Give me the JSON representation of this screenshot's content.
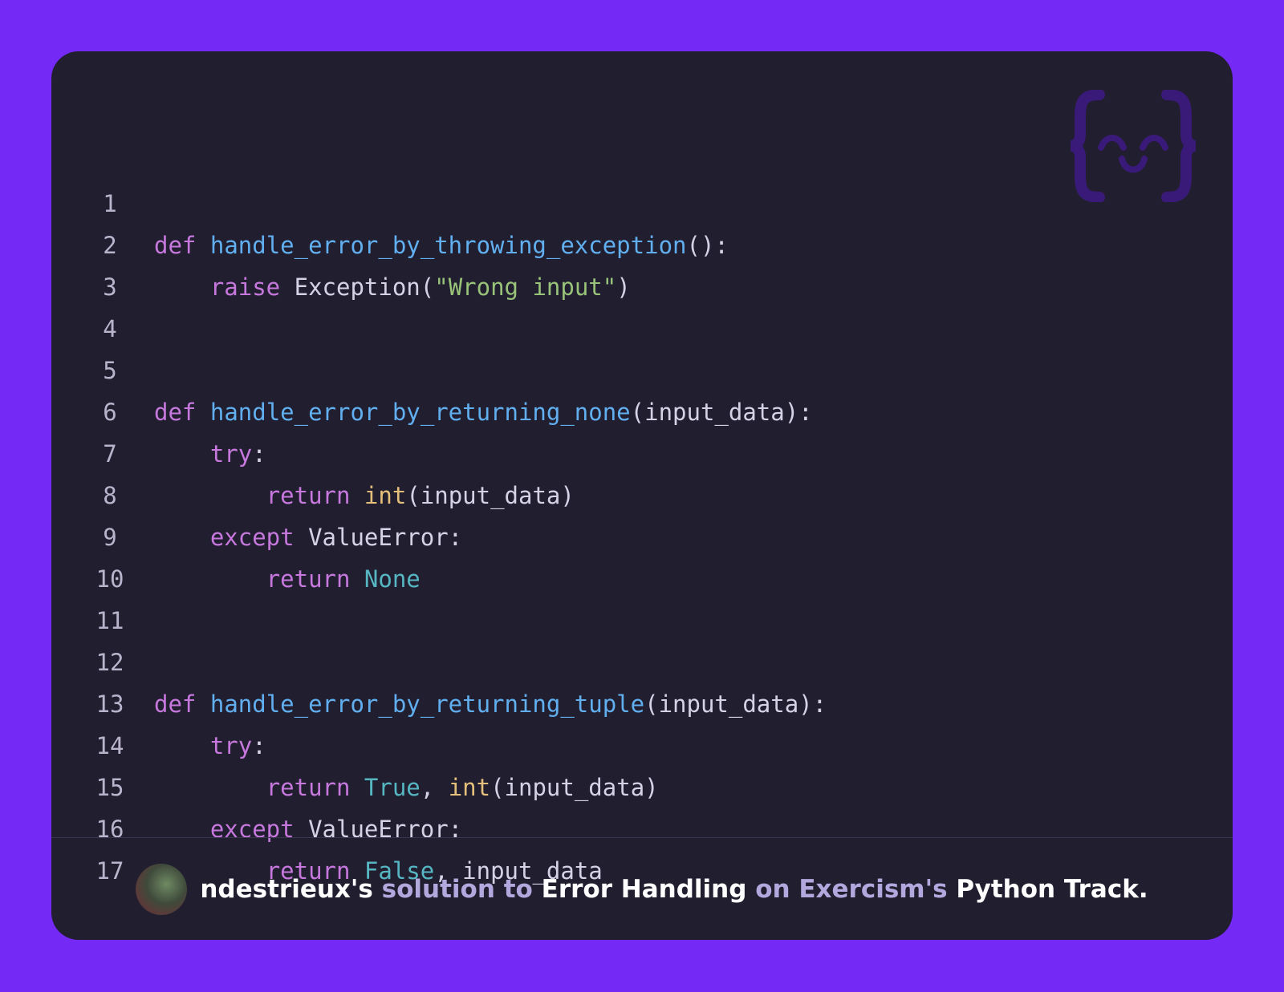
{
  "footer": {
    "user": "ndestrieux's",
    "solution_text": "solution to",
    "exercise": "Error Handling",
    "on_text": "on Exercism's",
    "track": "Python Track."
  },
  "icons": {
    "logo": "exercism-braces-face-icon",
    "avatar": "user-avatar"
  },
  "colors": {
    "background": "#7429f5",
    "card": "#211e30",
    "keyword": "#c678dd",
    "function": "#61afef",
    "string": "#98c379",
    "builtin": "#e5c07b",
    "constant": "#56b6c2",
    "text": "#d6d2e6"
  },
  "code": {
    "line_numbers": [
      "1",
      "2",
      "3",
      "4",
      "5",
      "6",
      "7",
      "8",
      "9",
      "10",
      "11",
      "12",
      "13",
      "14",
      "15",
      "16",
      "17"
    ],
    "l1": {
      "kw": "def",
      "fn": "handle_error_by_throwing_exception",
      "rest": "():"
    },
    "l2": {
      "kw": "raise",
      "call": "Exception(",
      "str": "\"Wrong input\"",
      "close": ")"
    },
    "l5": {
      "kw": "def",
      "fn": "handle_error_by_returning_none",
      "rest": "(input_data):"
    },
    "l6": {
      "kw": "try",
      "rest": ":"
    },
    "l7": {
      "kw": "return",
      "bi": "int",
      "rest": "(input_data)"
    },
    "l8": {
      "kw": "except",
      "rest": "ValueError:"
    },
    "l9": {
      "kw": "return",
      "cst": "None"
    },
    "l12": {
      "kw": "def",
      "fn": "handle_error_by_returning_tuple",
      "rest": "(input_data):"
    },
    "l13": {
      "kw": "try",
      "rest": ":"
    },
    "l14": {
      "kw": "return",
      "cst": "True",
      "sep": ",",
      "bi": "int",
      "rest": "(input_data)"
    },
    "l15": {
      "kw": "except",
      "rest": "ValueError:"
    },
    "l16": {
      "kw": "return",
      "cst": "False",
      "rest": ", input_data"
    }
  }
}
